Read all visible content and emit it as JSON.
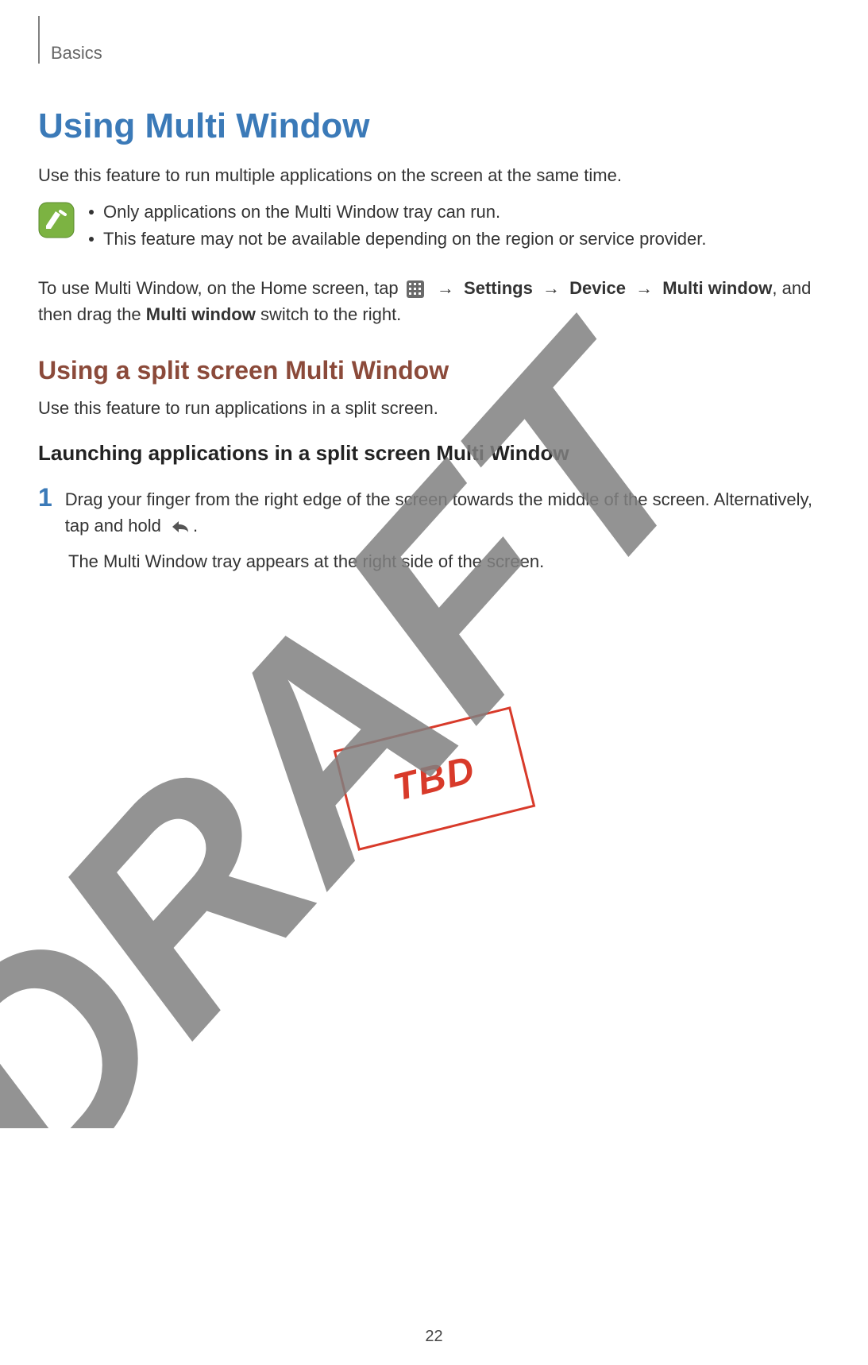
{
  "header": {
    "section": "Basics"
  },
  "title": "Using Multi Window",
  "intro": "Use this feature to run multiple applications on the screen at the same time.",
  "notes": {
    "item1": "Only applications on the Multi Window tray can run.",
    "item2": "This feature may not be available depending on the region or service provider."
  },
  "instruction": {
    "pre": "To use Multi Window, on the Home screen, tap ",
    "arrow": "→",
    "settings": "Settings",
    "device": "Device",
    "multiwindow": "Multi window",
    "post1": ", and then drag the ",
    "mw_bold": "Multi window",
    "post2": " switch to the right."
  },
  "section2": {
    "title": "Using a split screen Multi Window",
    "intro": "Use this feature to run applications in a split screen."
  },
  "section3": {
    "title": "Launching applications in a split screen Multi Window"
  },
  "step1": {
    "num": "1",
    "line1a": "Drag your finger from the right edge of the screen towards the middle of the screen. Alternatively, tap and hold ",
    "line1b": ".",
    "line2": "The Multi Window tray appears at the right side of the screen."
  },
  "tbd": "TBD",
  "page": "22",
  "watermark": "DRAFT"
}
